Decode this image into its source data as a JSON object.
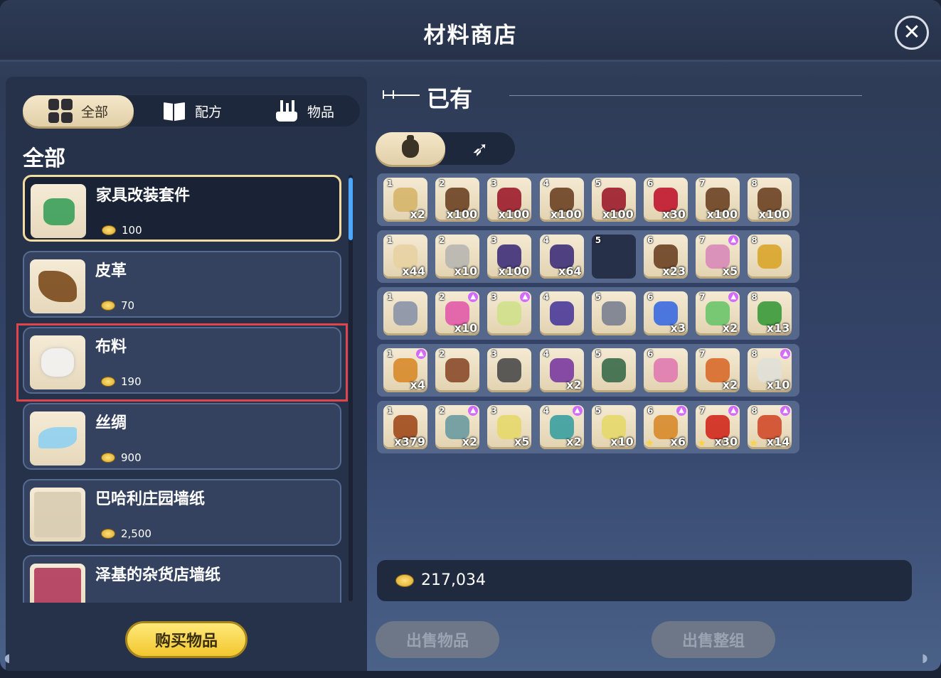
{
  "title": "材料商店",
  "filters": [
    {
      "label": "全部",
      "icon": "grid-icon"
    },
    {
      "label": "配方",
      "icon": "book-icon"
    },
    {
      "label": "物品",
      "icon": "crafting-icon"
    }
  ],
  "section_title": "全部",
  "items": [
    {
      "name": "家具改装套件",
      "price": "100",
      "color": "#3aa05a"
    },
    {
      "name": "皮革",
      "price": "70",
      "color": "#7a4a1c"
    },
    {
      "name": "布料",
      "price": "190",
      "color": "#f2f2f2"
    },
    {
      "name": "丝绸",
      "price": "900",
      "color": "#8fd0f0"
    },
    {
      "name": "巴哈利庄园墙纸",
      "price": "2,500",
      "color": "#d8ccb2"
    },
    {
      "name": "泽基的杂货店墙纸",
      "price": "",
      "color": "#b03a5c"
    }
  ],
  "buy_button": "购买物品",
  "owned_title": "已有",
  "inventory": [
    [
      {
        "n": "1",
        "q": "x2",
        "c": "#d6b56a"
      },
      {
        "n": "2",
        "q": "x100",
        "c": "#6b4124"
      },
      {
        "n": "3",
        "q": "x100",
        "c": "#9c1c2c"
      },
      {
        "n": "4",
        "q": "x100",
        "c": "#6b4124"
      },
      {
        "n": "5",
        "q": "x100",
        "c": "#9c1c2c"
      },
      {
        "n": "6",
        "q": "x30",
        "c": "#c0162c"
      },
      {
        "n": "7",
        "q": "x100",
        "c": "#6b4124"
      },
      {
        "n": "8",
        "q": "x100",
        "c": "#6b4124"
      }
    ],
    [
      {
        "n": "1",
        "q": "x44",
        "c": "#e8d2a2"
      },
      {
        "n": "2",
        "q": "x10",
        "c": "#b8b6b0"
      },
      {
        "n": "3",
        "q": "x100",
        "c": "#3e2f7a"
      },
      {
        "n": "4",
        "q": "x64",
        "c": "#3e2f7a"
      },
      {
        "n": "5",
        "q": "",
        "c": ""
      },
      {
        "n": "6",
        "q": "x23",
        "c": "#6b4124"
      },
      {
        "n": "7",
        "q": "x5",
        "c": "#d88ab8",
        "up": true
      },
      {
        "n": "8",
        "q": "",
        "c": "#d9a52a"
      }
    ],
    [
      {
        "n": "1",
        "q": "",
        "c": "#8a93a8"
      },
      {
        "n": "2",
        "q": "x10",
        "c": "#e25aa8",
        "up": true
      },
      {
        "n": "3",
        "q": "",
        "c": "#cfe08a",
        "up": true
      },
      {
        "n": "4",
        "q": "",
        "c": "#4a3a9a"
      },
      {
        "n": "5",
        "q": "",
        "c": "#7a8090"
      },
      {
        "n": "6",
        "q": "x3",
        "c": "#3a6ae0"
      },
      {
        "n": "7",
        "q": "x2",
        "c": "#6ac46a",
        "up": true
      },
      {
        "n": "8",
        "q": "x13",
        "c": "#3a9a3a"
      }
    ],
    [
      {
        "n": "1",
        "q": "x4",
        "c": "#d88a2a",
        "up": true
      },
      {
        "n": "2",
        "q": "",
        "c": "#8a4a2a"
      },
      {
        "n": "3",
        "q": "",
        "c": "#4a4a4a"
      },
      {
        "n": "4",
        "q": "x2",
        "c": "#7a3aa0"
      },
      {
        "n": "5",
        "q": "",
        "c": "#3a6a4a"
      },
      {
        "n": "6",
        "q": "",
        "c": "#e07ab0"
      },
      {
        "n": "7",
        "q": "x2",
        "c": "#d86a2a"
      },
      {
        "n": "8",
        "q": "x10",
        "c": "#e0e0d8",
        "up": true
      }
    ],
    [
      {
        "n": "1",
        "q": "x379",
        "c": "#a04a1c"
      },
      {
        "n": "2",
        "q": "x2",
        "c": "#6a9aa0",
        "up": true
      },
      {
        "n": "3",
        "q": "x5",
        "c": "#e6d86a"
      },
      {
        "n": "4",
        "q": "x2",
        "c": "#3aa0a0",
        "up": true
      },
      {
        "n": "5",
        "q": "x10",
        "c": "#e6d86a"
      },
      {
        "n": "6",
        "q": "x6",
        "c": "#d88a2a",
        "up": true,
        "star": true
      },
      {
        "n": "7",
        "q": "x30",
        "c": "#d0281c",
        "up": true,
        "star": true
      },
      {
        "n": "8",
        "q": "x14",
        "c": "#d04a2a",
        "up": true,
        "star": true
      }
    ]
  ],
  "money": "217,034",
  "sell_item": "出售物品",
  "sell_group": "出售整组"
}
